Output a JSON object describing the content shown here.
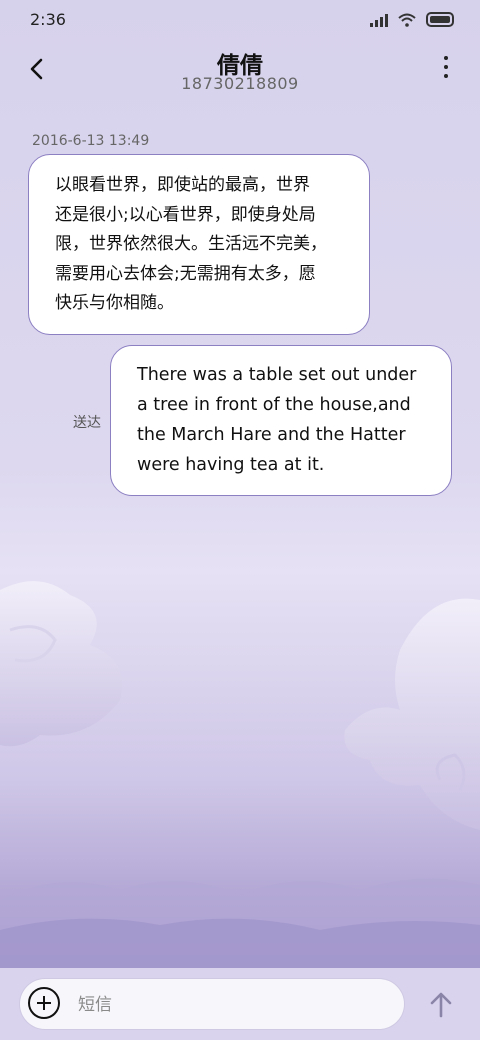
{
  "status_bar": {
    "time": "2:36"
  },
  "header": {
    "contact_name": "倩倩",
    "phone_number": "18730218809"
  },
  "conversation": {
    "timestamp": "2016-6-13 13:49",
    "messages": [
      {
        "direction": "incoming",
        "lines": [
          "以眼看世界，即使站的最高，世界",
          "还是很小;以心看世界，即使身处局",
          "限，世界依然很大。生活远不完美，",
          "需要用心去体会;无需拥有太多，愿",
          "快乐与你相随。"
        ]
      },
      {
        "direction": "outgoing",
        "status": "送达",
        "lines": [
          "There was a table set out under",
          "a tree in front of the house,and",
          "the March Hare and the Hatter",
          "were having tea at it."
        ]
      }
    ]
  },
  "composer": {
    "placeholder": "短信"
  },
  "icons": {
    "back": "chevron-left-icon",
    "menu": "more-vertical-icon",
    "add": "plus-circle-icon",
    "send": "arrow-up-icon",
    "signal": "cellular-signal-icon",
    "wifi": "wifi-icon",
    "battery": "battery-icon"
  },
  "colors": {
    "bubble_border": "#8c7fc2",
    "background_top": "#d7d2ec",
    "background_bottom": "#9c8fc6"
  }
}
